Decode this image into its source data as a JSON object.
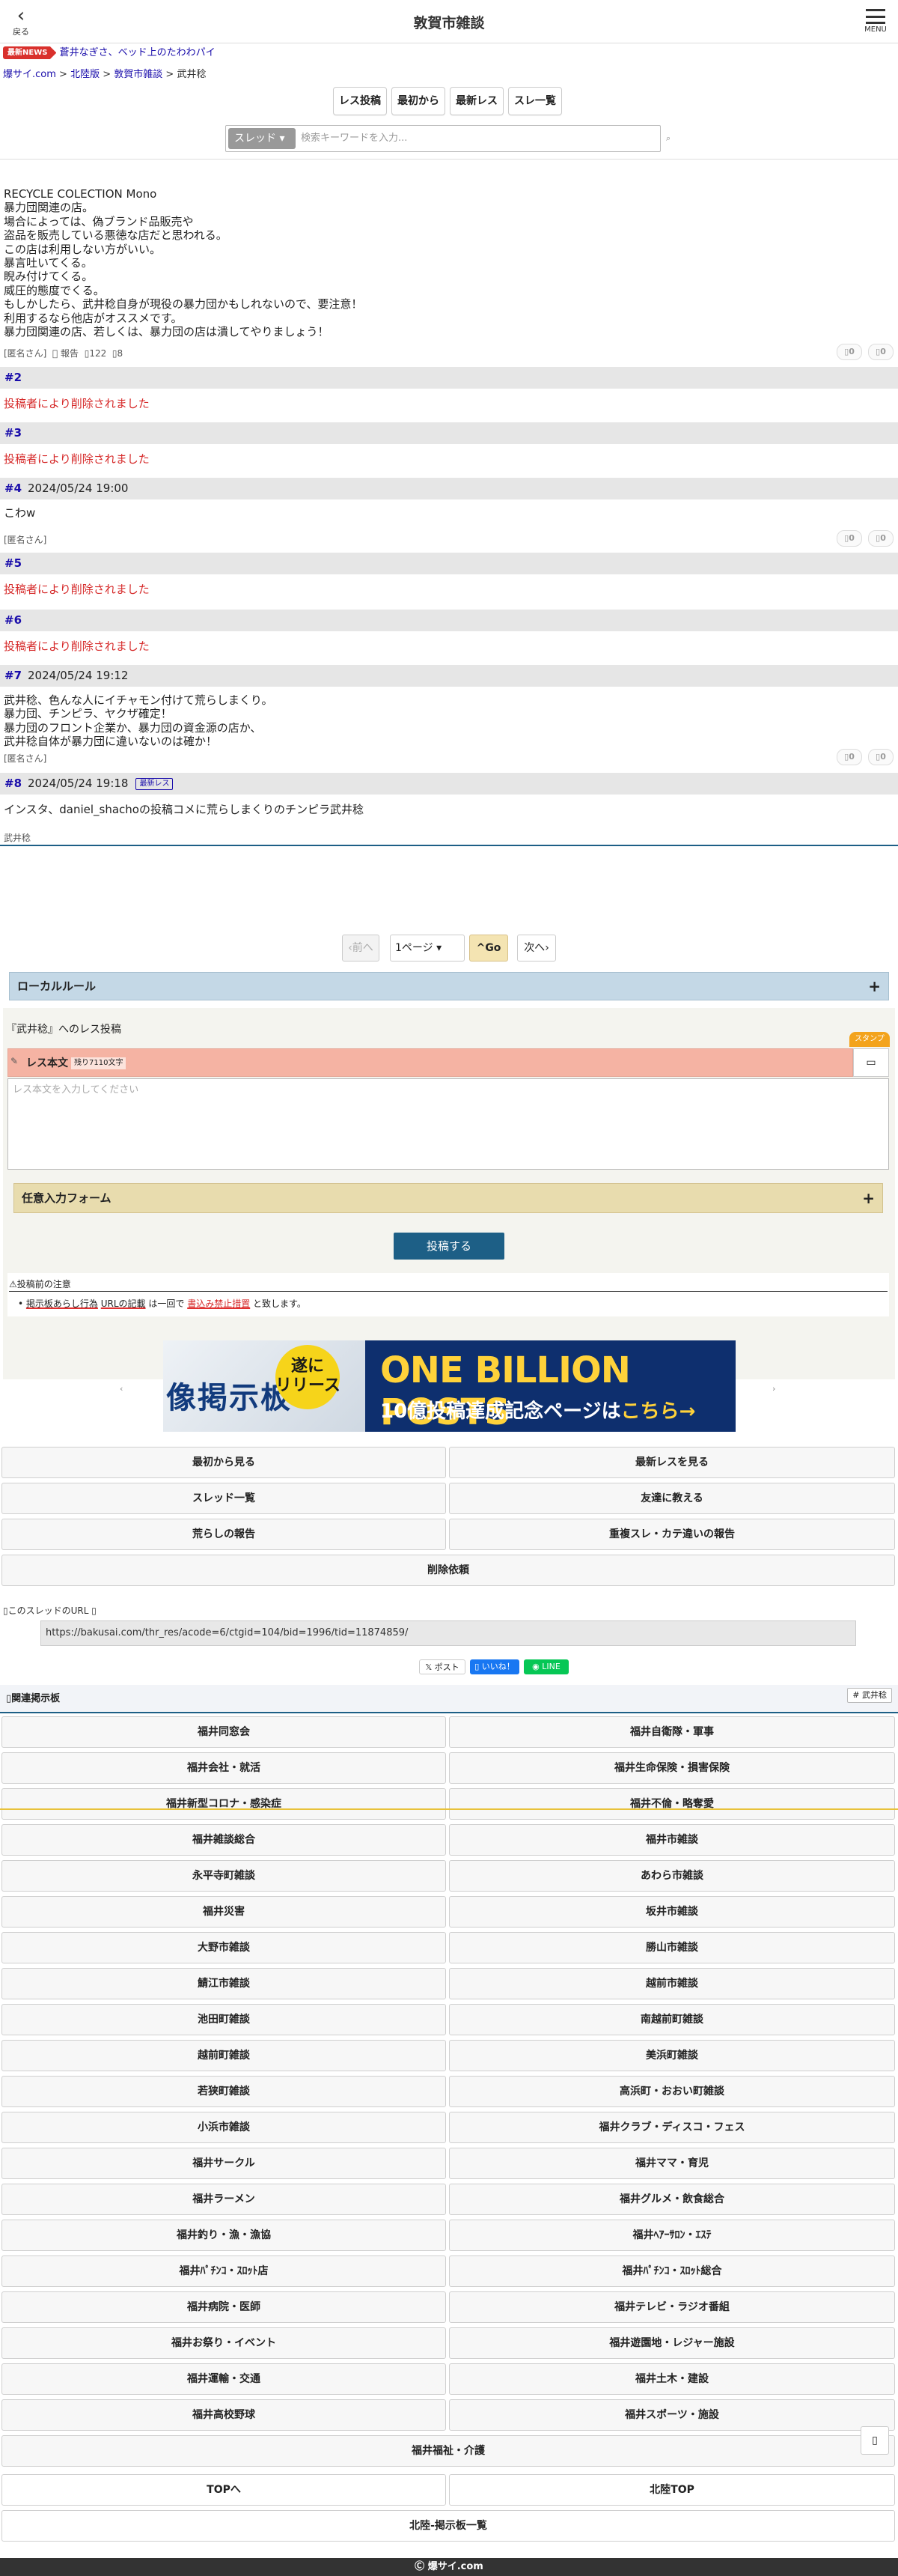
{
  "header": {
    "back_icon": "chevron-left-icon",
    "back_label": "戻る",
    "title": "敦賀市雑談",
    "menu_icon": "hamburger-icon",
    "menu_label": "MENU"
  },
  "news": {
    "badge": "最新NEWS",
    "text": "蒼井なぎさ、ベッド上のたわわパイ"
  },
  "breadcrumb": {
    "items": [
      "爆サイ.com",
      "北陸版",
      "敦賀市雑談"
    ],
    "sep": " > ",
    "current": "武井稔"
  },
  "toolbar": {
    "buttons": [
      "レス投稿",
      "最初から",
      "最新レス",
      "スレ一覧"
    ]
  },
  "search": {
    "scope": "スレッド",
    "placeholder": "検索キーワードを入力...",
    "icon": "search-icon"
  },
  "posts": [
    {
      "id": "1",
      "body": "RECYCLE COLECTION Mono\n暴力団関連の店。\n場合によっては、偽ブランド品販売や\n盗品を販売している悪徳な店だと思われる。\nこの店は利用しない方がいい。\n暴言吐いてくる。\n睨み付けてくる。\n威圧的態度でくる。\nもしかしたら、武井稔自身が現役の暴力団かもしれないので、要注意！\n利用するなら他店がオススメです。\n暴力団関連の店、若しくは、暴力団の店は潰してやりましょう！",
      "author": "[匿名さん]",
      "report": "報告",
      "views": "122",
      "count": "8",
      "up": "0",
      "down": "0"
    },
    {
      "id": "#2",
      "deleted": "投稿者により削除されました"
    },
    {
      "id": "#3",
      "deleted": "投稿者により削除されました"
    },
    {
      "id": "#4",
      "date": "2024/05/24 19:00",
      "body": "こわw",
      "author": "[匿名さん]",
      "up": "0",
      "down": "0"
    },
    {
      "id": "#5",
      "deleted": "投稿者により削除されました"
    },
    {
      "id": "#6",
      "deleted": "投稿者により削除されました"
    },
    {
      "id": "#7",
      "date": "2024/05/24 19:12",
      "body": "武井稔、色んな人にイチャモン付けて荒らしまくり。\n暴力団、チンピラ、ヤクザ確定！\n暴力団のフロント企業か、暴力団の資金源の店か、\n武井稔自体が暴力団に違いないのは確か！",
      "author": "[匿名さん]",
      "up": "0",
      "down": "0"
    },
    {
      "id": "#8",
      "date": "2024/05/24 19:18",
      "badge": "最新レス",
      "body": "インスタ、daniel_shachoの投稿コメに荒らしまくりのチンピラ武井稔",
      "author": "武井稔"
    }
  ],
  "pager": {
    "prev": "前へ",
    "page": "1ページ",
    "go": "Go",
    "next": "次へ"
  },
  "local_rule": {
    "label": "ローカルルール",
    "toggle": "+"
  },
  "form": {
    "reply_to": "『武井稔』へのレス投稿",
    "stamp": "スタンプ",
    "body_label": "レス本文",
    "remaining": "残り7110文字",
    "textarea_placeholder": "レス本文を入力してください",
    "optional": "任意入力フォーム",
    "submit": "投稿する"
  },
  "notice": {
    "title": "⚠投稿前の注意",
    "item_a": "掲示板あらし行為",
    "item_b": "URLの記載",
    "mid": " は一回で ",
    "item_c": "書込み禁止措置",
    "tail": " と致します。"
  },
  "banner": {
    "left_text": "像掲示板",
    "circle_text": "遂に\nリリース",
    "headline": "ONE BILLION POSTS",
    "sub": "10億投稿達成記念ページは",
    "sub_accent": "こちら→"
  },
  "actions": [
    "最初から見る",
    "最新レスを見る",
    "スレッド一覧",
    "友達に教える",
    "荒らしの報告",
    "重複スレ・カテ違いの報告",
    "削除依頼"
  ],
  "thread_url": {
    "label": "このスレッドのURL",
    "value": "https://bakusai.com/thr_res/acode=6/ctgid=104/bid=1996/tid=11874859/"
  },
  "sns": {
    "post": "ポスト",
    "like": "いいね！",
    "line": "LINE"
  },
  "related": {
    "title": "関連掲示板",
    "tag": "# 武井稔",
    "boards": [
      "福井同窓会",
      "福井自衛隊・軍事",
      "福井会社・就活",
      "福井生命保険・損害保険",
      "福井新型コロナ・感染症",
      "福井不倫・略奪愛",
      "福井雑談総合",
      "福井市雑談",
      "永平寺町雑談",
      "あわら市雑談",
      "福井災害",
      "坂井市雑談",
      "大野市雑談",
      "勝山市雑談",
      "鯖江市雑談",
      "越前市雑談",
      "池田町雑談",
      "南越前町雑談",
      "越前町雑談",
      "美浜町雑談",
      "若狭町雑談",
      "高浜町・おおい町雑談",
      "小浜市雑談",
      "福井クラブ・ディスコ・フェス",
      "福井サークル",
      "福井ママ・育児",
      "福井ラーメン",
      "福井グルメ・飲食総合",
      "福井釣り・漁・漁協",
      "福井ﾍｱｰｻﾛﾝ・ｴｽﾃ",
      "福井ﾊﾟﾁﾝｺ・ｽﾛｯﾄ店",
      "福井ﾊﾟﾁﾝｺ・ｽﾛｯﾄ総合",
      "福井病院・医師",
      "福井テレビ・ラジオ番組",
      "福井お祭り・イベント",
      "福井遊園地・レジャー施設",
      "福井運輸・交通",
      "福井土木・建設",
      "福井高校野球",
      "福井スポーツ・施設",
      "福井福祉・介護"
    ]
  },
  "bottom_nav": [
    "TOPへ",
    "北陸TOP",
    "北陸-掲示板一覧"
  ],
  "footer": "Ⓒ 爆サイ.com",
  "colors": {
    "accent": "#1d5f86",
    "deleted": "#d62a2a",
    "link": "#1a0dab"
  }
}
